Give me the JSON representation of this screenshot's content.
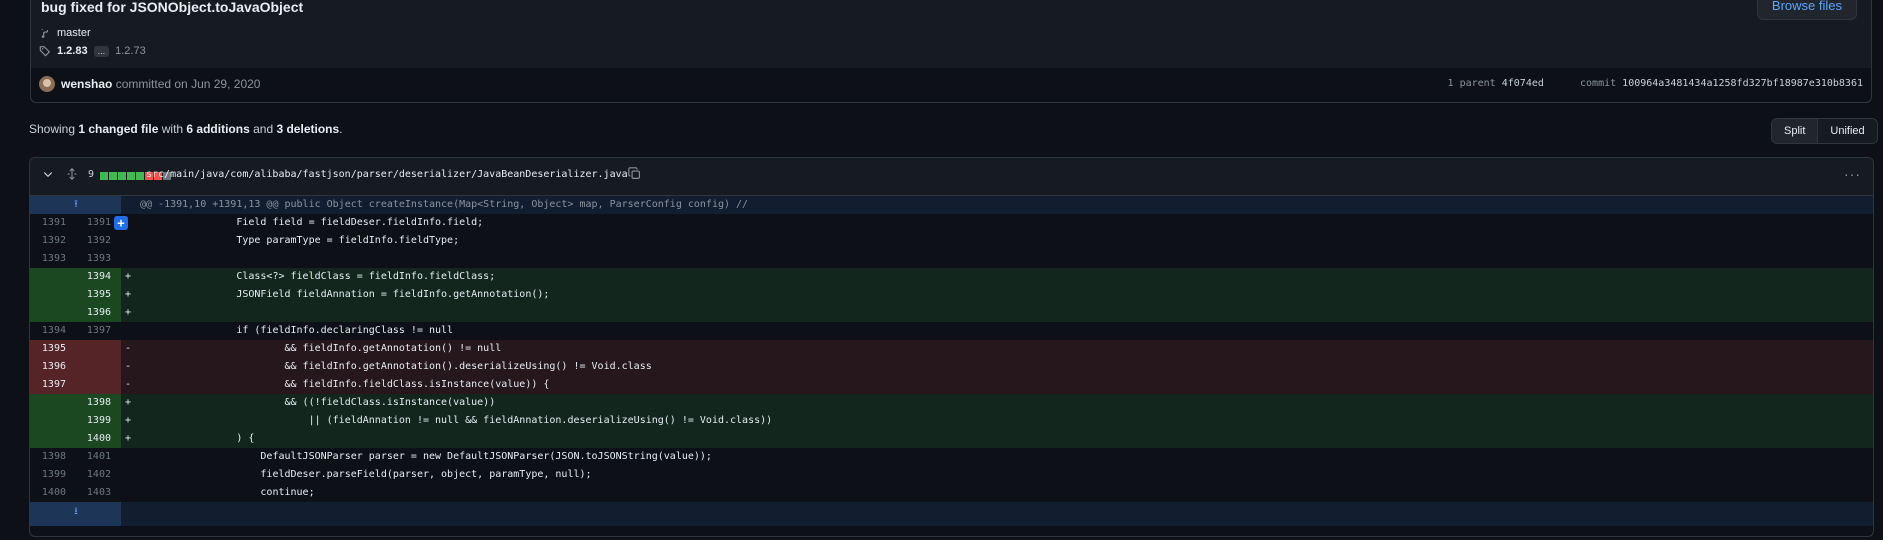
{
  "commit": {
    "title": "bug fixed for JSONObject.toJavaObject",
    "branch": "master",
    "tag_first": "1.2.83",
    "tag_more": "...",
    "tag_last": "1.2.73",
    "browse_files_label": "Browse files",
    "author": "wenshao",
    "committed_text": "committed on Jun 29, 2020",
    "parent_label": "1 parent",
    "parent_hash": "4f074ed",
    "commit_label": "commit",
    "commit_hash": "100964a3481434a1258fd327bf18987e310b8361"
  },
  "summary": {
    "prefix": "Showing ",
    "files": "1 changed file",
    "mid1": " with ",
    "additions": "6 additions",
    "mid2": " and ",
    "deletions": "3 deletions",
    "suffix": "."
  },
  "view_toggle": {
    "split": "Split",
    "unified": "Unified"
  },
  "file": {
    "change_count": "9",
    "path": "src/main/java/com/alibaba/fastjson/parser/deserializer/JavaBeanDeserializer.java",
    "hunk_header": "@@ -1391,10 +1391,13 @@ public Object createInstance(Map<String, Object> map, ParserConfig config) //",
    "lines": [
      {
        "old": "1391",
        "new": "1391",
        "type": "ctx",
        "code": "                Field field = fieldDeser.fieldInfo.field;"
      },
      {
        "old": "1392",
        "new": "1392",
        "type": "ctx",
        "code": "                Type paramType = fieldInfo.fieldType;"
      },
      {
        "old": "1393",
        "new": "1393",
        "type": "ctx",
        "code": ""
      },
      {
        "old": "",
        "new": "1394",
        "type": "add",
        "code": "                Class<?> fieldClass = fieldInfo.fieldClass;"
      },
      {
        "old": "",
        "new": "1395",
        "type": "add",
        "code": "                JSONField fieldAnnation = fieldInfo.getAnnotation();"
      },
      {
        "old": "",
        "new": "1396",
        "type": "add",
        "code": ""
      },
      {
        "old": "1394",
        "new": "1397",
        "type": "ctx",
        "code": "                if (fieldInfo.declaringClass != null"
      },
      {
        "old": "1395",
        "new": "",
        "type": "del",
        "code": "                        && fieldInfo.getAnnotation() != null"
      },
      {
        "old": "1396",
        "new": "",
        "type": "del",
        "code": "                        && fieldInfo.getAnnotation().deserializeUsing() != Void.class"
      },
      {
        "old": "1397",
        "new": "",
        "type": "del",
        "code": "                        && fieldInfo.fieldClass.isInstance(value)) {"
      },
      {
        "old": "",
        "new": "1398",
        "type": "add",
        "code": "                        && ((!fieldClass.isInstance(value))"
      },
      {
        "old": "",
        "new": "1399",
        "type": "add",
        "code": "                            || (fieldAnnation != null && fieldAnnation.deserializeUsing() != Void.class))"
      },
      {
        "old": "",
        "new": "1400",
        "type": "add",
        "code": "                ) {"
      },
      {
        "old": "1398",
        "new": "1401",
        "type": "ctx",
        "code": "                    DefaultJSONParser parser = new DefaultJSONParser(JSON.toJSONString(value));"
      },
      {
        "old": "1399",
        "new": "1402",
        "type": "ctx",
        "code": "                    fieldDeser.parseField(parser, object, paramType, null);"
      },
      {
        "old": "1400",
        "new": "1403",
        "type": "ctx",
        "code": "                    continue;"
      }
    ]
  },
  "diffstat_colors": [
    "#3fb950",
    "#3fb950",
    "#3fb950",
    "#3fb950",
    "#3fb950",
    "#f85149",
    "#f85149",
    "#6e7681"
  ]
}
